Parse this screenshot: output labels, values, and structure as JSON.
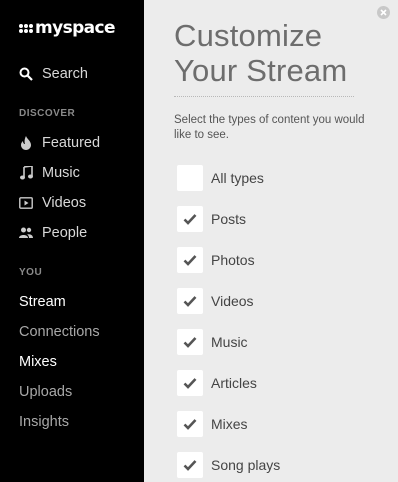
{
  "brand": {
    "name": "myspace"
  },
  "sidebar": {
    "search_label": "Search",
    "discover_label": "DISCOVER",
    "discover_items": [
      {
        "label": "Featured",
        "icon": "flame-icon"
      },
      {
        "label": "Music",
        "icon": "music-note-icon"
      },
      {
        "label": "Videos",
        "icon": "video-icon"
      },
      {
        "label": "People",
        "icon": "people-icon"
      }
    ],
    "you_label": "YOU",
    "you_items": [
      {
        "label": "Stream",
        "active": true
      },
      {
        "label": "Connections",
        "active": false
      },
      {
        "label": "Mixes",
        "active": true
      },
      {
        "label": "Uploads",
        "active": false
      },
      {
        "label": "Insights",
        "active": false
      }
    ]
  },
  "panel": {
    "title_line1": "Customize",
    "title_line2": "Your Stream",
    "description": "Select the types of content you would like to see.",
    "options": [
      {
        "label": "All types",
        "checked": false
      },
      {
        "label": "Posts",
        "checked": true
      },
      {
        "label": "Photos",
        "checked": true
      },
      {
        "label": "Videos",
        "checked": true
      },
      {
        "label": "Music",
        "checked": true
      },
      {
        "label": "Articles",
        "checked": true
      },
      {
        "label": "Mixes",
        "checked": true
      },
      {
        "label": "Song plays",
        "checked": true
      }
    ]
  },
  "colors": {
    "sidebar_bg": "#000000",
    "panel_bg": "#ececec",
    "title_color": "#6d6d6d",
    "checkmark": "#555555"
  }
}
